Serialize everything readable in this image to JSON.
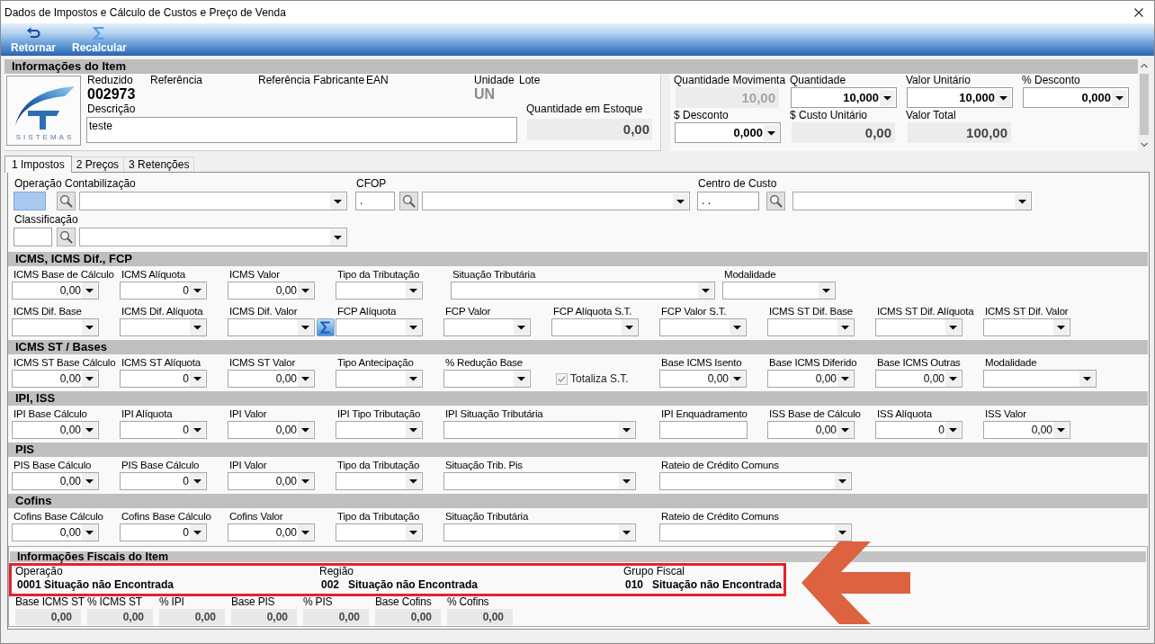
{
  "window": {
    "title": "Dados de Impostos e Cálculo de Custos e Preço de Venda"
  },
  "toolbar": [
    {
      "label": "Retornar",
      "kind": "return"
    },
    {
      "label": "Recalcular",
      "kind": "recalculate"
    }
  ],
  "item_info": {
    "title": "Informações do Item",
    "logo_text": "SISTEMAS",
    "identifiers": [
      {
        "label": "Reduzido",
        "value": "002973",
        "disabled": false
      },
      {
        "label": "Referência"
      },
      {
        "label": "Referência Fabricante"
      },
      {
        "label": "EAN"
      },
      {
        "label": "Unidade",
        "value": "UN",
        "disabled": true
      },
      {
        "label": "Lote"
      }
    ],
    "description": {
      "label": "Descrição",
      "value": "teste"
    },
    "stock": {
      "label": "Quantidade em Estoque",
      "value": "0,00"
    },
    "quantities": [
      {
        "label": "Quantidade Movimenta",
        "kind": "readonly",
        "value": "10,00",
        "disabled": true
      },
      {
        "label": "Quantidade",
        "kind": "select",
        "value": "10,000",
        "disabled": false
      },
      {
        "label": "Valor Unitário",
        "kind": "select",
        "value": "10,000",
        "disabled": false
      },
      {
        "label": "% Desconto",
        "kind": "select",
        "value": "0,000",
        "disabled": false
      },
      {
        "label": "$ Desconto",
        "kind": "select",
        "value": "0,000",
        "disabled": false
      },
      {
        "label": "$ Custo Unitário",
        "kind": "readonly",
        "value": "0,00",
        "disabled": false
      },
      {
        "label": "Valor Total",
        "kind": "readonly",
        "value": "100,00",
        "disabled": false
      }
    ]
  },
  "tabs": [
    {
      "label": "1 Impostos",
      "selected": true
    },
    {
      "label": "2 Preços",
      "selected": false
    },
    {
      "label": "3 Retenções",
      "selected": false
    }
  ],
  "tax": {
    "lookups": [
      {
        "label": "Operação Contabilização",
        "focused": true
      },
      {
        "label": "CFOP",
        "code": ".",
        "focused": false
      },
      {
        "label": "Centro de Custo",
        "code": ". .",
        "focused": false
      },
      {
        "label": "Classificação",
        "focused": false
      }
    ],
    "sections": [
      {
        "title": "ICMS, ICMS Dif., FCP",
        "rows": [
          {
            "fields": [
              {
                "label": "ICMS Base de Cálculo",
                "kind": "select",
                "value": "0,00"
              },
              {
                "label": "ICMS Alíquota",
                "kind": "select",
                "value": "0"
              },
              {
                "label": "ICMS Valor",
                "kind": "select",
                "value": "0,00"
              },
              {
                "label": "Tipo da Tributação",
                "kind": "select"
              },
              {
                "label": "Situação Tributária",
                "kind": "longselect"
              },
              {
                "label": "Modalidade",
                "kind": "medselect"
              }
            ]
          },
          {
            "fields": [
              {
                "label": "ICMS Dif. Base",
                "kind": "select"
              },
              {
                "label": "ICMS Dif. Alíquota",
                "kind": "select"
              },
              {
                "label": "ICMS Dif. Valor",
                "kind": "calcselect"
              },
              {
                "label": "FCP Alíquota",
                "kind": "select"
              },
              {
                "label": "FCP Valor",
                "kind": "select"
              },
              {
                "label": "FCP Alíquota S.T.",
                "kind": "select"
              },
              {
                "label": "FCP Valor S.T.",
                "kind": "select"
              },
              {
                "label": "ICMS ST Dif. Base",
                "kind": "select"
              },
              {
                "label": "ICMS ST Dif. Alíquota",
                "kind": "select"
              },
              {
                "label": "ICMS ST Dif. Valor",
                "kind": "select"
              }
            ]
          }
        ]
      },
      {
        "title": "ICMS ST / Bases",
        "rows": [
          {
            "fields": [
              {
                "label": "ICMS ST Base Cálculo",
                "kind": "select",
                "value": "0,00"
              },
              {
                "label": "ICMS ST Alíquota",
                "kind": "select",
                "value": "0"
              },
              {
                "label": "ICMS ST Valor",
                "kind": "select",
                "value": "0,00"
              },
              {
                "label": "Tipo Antecipação",
                "kind": "select"
              },
              {
                "label": "% Redução Base",
                "kind": "select"
              },
              {
                "label": "Totaliza S.T.",
                "kind": "check",
                "checked": true,
                "disabled": true
              },
              {
                "label": "Base ICMS Isento",
                "kind": "select",
                "value": "0,00"
              },
              {
                "label": "Base ICMS Diferido",
                "kind": "select",
                "value": "0,00"
              },
              {
                "label": "Base ICMS Outras",
                "kind": "select",
                "value": "0,00"
              },
              {
                "label": "Modalidade",
                "kind": "medselect"
              }
            ]
          }
        ]
      },
      {
        "title": "IPI, ISS",
        "rows": [
          {
            "fields": [
              {
                "label": "IPI Base Cálculo",
                "kind": "select",
                "value": "0,00"
              },
              {
                "label": "IPI Alíquota",
                "kind": "select",
                "value": "0"
              },
              {
                "label": "IPI Valor",
                "kind": "select",
                "value": "0,00"
              },
              {
                "label": "IPI Tipo Tributação",
                "kind": "select"
              },
              {
                "label": "IPI Situação Tributária",
                "kind": "wideselect"
              },
              {
                "label": "IPI Enquadramento",
                "kind": "input"
              },
              {
                "label": "ISS Base de Cálculo",
                "kind": "select",
                "value": "0,00"
              },
              {
                "label": "ISS Alíquota",
                "kind": "select",
                "value": "0"
              },
              {
                "label": "ISS Valor",
                "kind": "select",
                "value": "0,00"
              }
            ]
          }
        ]
      },
      {
        "title": "PIS",
        "rows": [
          {
            "fields": [
              {
                "label": "PIS Base Cálculo",
                "kind": "select",
                "value": "0,00"
              },
              {
                "label": "PIS Base Cálculo",
                "kind": "select",
                "value": "0"
              },
              {
                "label": "IPI Valor",
                "kind": "select",
                "value": "0,00"
              },
              {
                "label": "Tipo da Tributação",
                "kind": "select"
              },
              {
                "label": "Situação Trib. Pis",
                "kind": "wideselect"
              },
              {
                "label": "Rateio de Crédito Comuns",
                "kind": "wideselect"
              }
            ]
          }
        ]
      },
      {
        "title": "Cofins",
        "rows": [
          {
            "fields": [
              {
                "label": "Cofins Base Cálculo",
                "kind": "select",
                "value": "0,00"
              },
              {
                "label": "Cofins Base Cálculo",
                "kind": "select",
                "value": "0"
              },
              {
                "label": "Cofins Valor",
                "kind": "select",
                "value": "0,00"
              },
              {
                "label": "Tipo da Tributação",
                "kind": "select"
              },
              {
                "label": "Situação Tributária",
                "kind": "wideselect"
              },
              {
                "label": "Rateio de Crédito Comuns",
                "kind": "wideselect"
              }
            ]
          }
        ]
      }
    ]
  },
  "fiscal_info": {
    "title": "Informações Fiscais do Item",
    "groups": [
      {
        "label": "Operação",
        "code": "0001",
        "status": "Situação não Encontrada"
      },
      {
        "label": "Região",
        "code": "002",
        "status": "Situação não Encontrada"
      },
      {
        "label": "Grupo Fiscal",
        "code": "010",
        "status": "Situação não Encontrada"
      }
    ],
    "totals": [
      {
        "label": "Base ICMS ST",
        "value": "0,00"
      },
      {
        "label": "% ICMS ST",
        "value": "0,00"
      },
      {
        "label": "% IPI",
        "value": "0,00"
      },
      {
        "label": "Base PIS",
        "value": "0,00"
      },
      {
        "label": "% PIS",
        "value": "0,00"
      },
      {
        "label": "Base Cofins",
        "value": "0,00"
      },
      {
        "label": "% Cofins",
        "value": "0,00"
      }
    ]
  }
}
